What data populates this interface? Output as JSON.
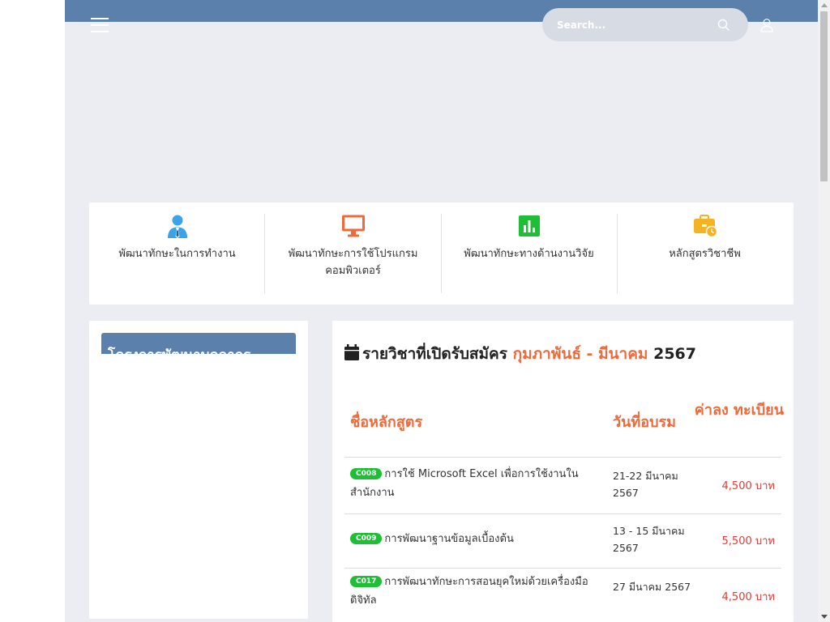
{
  "header": {
    "search_placeholder": "Search...",
    "colors": {
      "topbar": "#5a80ab",
      "accent": "#ee6a3a",
      "price": "#e53935",
      "badge": "#1fbf35"
    }
  },
  "categories": [
    {
      "icon": "user-tie-icon",
      "color": "#3da3e8",
      "label": "พัฒนาทักษะในการทำงาน"
    },
    {
      "icon": "monitor-icon",
      "color": "#ee6a3a",
      "label": "พัฒนาทักษะการใช้โปรแกรม คอมพิวเตอร์"
    },
    {
      "icon": "bar-chart-icon",
      "color": "#1fbf35",
      "label": "พัฒนาทักษะทางด้านงานวิจัย"
    },
    {
      "icon": "briefcase-clock-icon",
      "color": "#f5b324",
      "label": "หลักสูตรวิชาชีพ"
    }
  ],
  "sidebar": {
    "banner_text": "โครงการพัฒนาบุคลากร"
  },
  "courses": {
    "title_prefix": "รายวิชาที่เปิดรับสมัคร",
    "title_period": "กุมภาพันธ์ - มีนาคม",
    "title_year": "2567",
    "headers": {
      "name": "ชื่อหลักสูตร",
      "date": "วันที่อบรม",
      "fee": "ค่าลง ทะเบียน"
    },
    "rows": [
      {
        "code": "C008",
        "name": "การใช้ Microsoft Excel เพื่อการใช้งานในสำนักงาน",
        "date": "21-22 มีนาคม 2567",
        "fee": "4,500 บาท"
      },
      {
        "code": "C009",
        "name": "การพัฒนาฐานข้อมูลเบื้องต้น",
        "date": "13 - 15 มีนาคม 2567",
        "fee": "5,500 บาท"
      },
      {
        "code": "C017",
        "name": "การพัฒนาทักษะการสอนยุคใหม่ด้วยเครื่องมือดิจิทัล",
        "date": "27 มีนาคม 2567",
        "fee": "4,500 บาท"
      }
    ]
  }
}
